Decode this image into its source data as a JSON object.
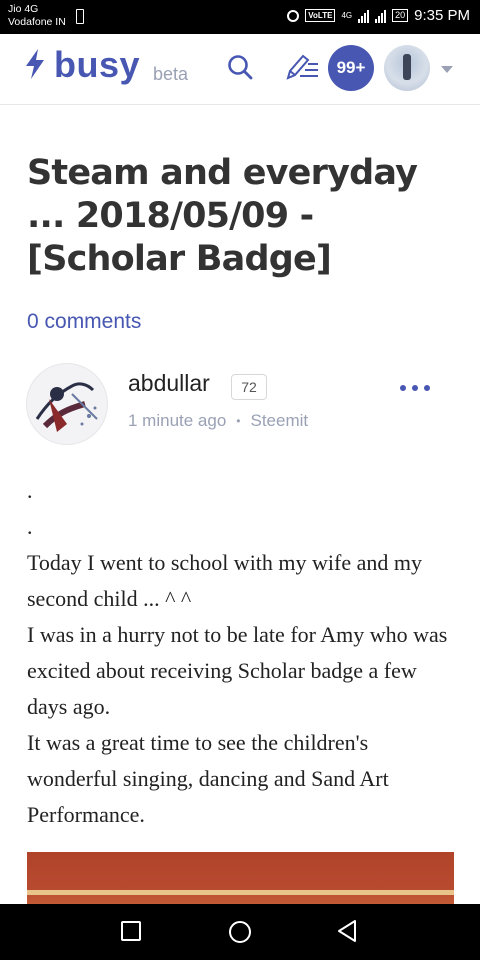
{
  "status_bar": {
    "carrier_1": "Jio 4G",
    "carrier_2": "Vodafone IN",
    "volte": "VoLTE",
    "network": "4G",
    "battery": "20",
    "time": "9:35 PM"
  },
  "header": {
    "logo_text": "busy",
    "beta_label": "beta",
    "notifications_count": "99+",
    "brand_color": "#4757b2"
  },
  "post": {
    "title": "Steam and everyday ... 2018/05/09 - [Scholar Badge]",
    "comments_label": "0 comments",
    "author": {
      "name": "abdullar",
      "reputation": "72",
      "time_ago": "1 minute ago",
      "separator": "•",
      "app": "Steemit"
    },
    "body": {
      "dot_1": ".",
      "dot_2": ".",
      "line_1": "Today I went to school with my wife and my second child ... ^ ^",
      "line_2": "I was in a hurry not to be late for Amy who was excited about receiving Scholar badge a few days ago.",
      "line_3": "It was a great time to see the children's wonderful singing, dancing and Sand Art Performance."
    }
  },
  "icons": {
    "logo": "lightning-bolt-icon",
    "search": "search-icon",
    "write": "pencil-edit-icon",
    "more": "ellipsis-icon",
    "nav_back": "square-icon",
    "nav_home": "circle-icon",
    "nav_recent": "triangle-back-icon"
  }
}
